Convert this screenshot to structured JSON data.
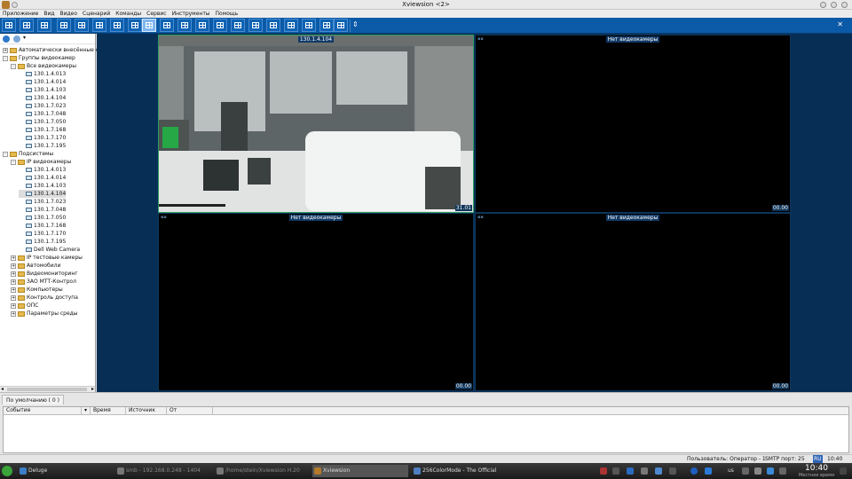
{
  "window": {
    "title": "Xviewsion <2>"
  },
  "menu": [
    "Приложение",
    "Вид",
    "Видео",
    "Сценарий",
    "Команды",
    "Сервис",
    "Инструменты",
    "Помощь"
  ],
  "tree": [
    {
      "level": 0,
      "type": "folder",
      "expand": "+",
      "label": "Автоматически внесённые объ"
    },
    {
      "level": 0,
      "type": "folder",
      "expand": "-",
      "label": "Группы видеокамер"
    },
    {
      "level": 1,
      "type": "folder",
      "expand": "-",
      "label": "Все видеокамеры"
    },
    {
      "level": 2,
      "type": "cam",
      "label": "130.1.4.013"
    },
    {
      "level": 2,
      "type": "cam",
      "label": "130.1.4.014"
    },
    {
      "level": 2,
      "type": "cam",
      "label": "130.1.4.103"
    },
    {
      "level": 2,
      "type": "cam",
      "label": "130.1.4.104"
    },
    {
      "level": 2,
      "type": "cam",
      "label": "130.1.7.023"
    },
    {
      "level": 2,
      "type": "cam",
      "label": "130.1.7.048"
    },
    {
      "level": 2,
      "type": "cam",
      "label": "130.1.7.050"
    },
    {
      "level": 2,
      "type": "cam",
      "label": "130.1.7.168"
    },
    {
      "level": 2,
      "type": "cam",
      "label": "130.1.7.170"
    },
    {
      "level": 2,
      "type": "cam",
      "label": "130.1.7.195"
    },
    {
      "level": 0,
      "type": "folder",
      "expand": "-",
      "label": "Подсистемы"
    },
    {
      "level": 1,
      "type": "folder",
      "expand": "-",
      "label": "IP видеокамеры"
    },
    {
      "level": 2,
      "type": "cam",
      "label": "130.1.4.013"
    },
    {
      "level": 2,
      "type": "cam",
      "label": "130.1.4.014"
    },
    {
      "level": 2,
      "type": "cam",
      "label": "130.1.4.103"
    },
    {
      "level": 2,
      "type": "cam",
      "label": "130.1.4.104",
      "selected": true
    },
    {
      "level": 2,
      "type": "cam",
      "label": "130.1.7.023"
    },
    {
      "level": 2,
      "type": "cam",
      "label": "130.1.7.048"
    },
    {
      "level": 2,
      "type": "cam",
      "label": "130.1.7.050"
    },
    {
      "level": 2,
      "type": "cam",
      "label": "130.1.7.168"
    },
    {
      "level": 2,
      "type": "cam",
      "label": "130.1.7.170"
    },
    {
      "level": 2,
      "type": "cam",
      "label": "130.1.7.195"
    },
    {
      "level": 2,
      "type": "cam",
      "label": "Dell Web Camera"
    },
    {
      "level": 1,
      "type": "folder",
      "expand": "+",
      "label": "IP тестовые камеры"
    },
    {
      "level": 1,
      "type": "folder",
      "expand": "+",
      "label": "Автомобили"
    },
    {
      "level": 1,
      "type": "folder",
      "expand": "+",
      "label": "Видеомониторинг"
    },
    {
      "level": 1,
      "type": "folder",
      "expand": "+",
      "label": "ЗАО МТТ-Контрол"
    },
    {
      "level": 1,
      "type": "folder",
      "expand": "+",
      "label": "Компьютеры"
    },
    {
      "level": 1,
      "type": "folder",
      "expand": "+",
      "label": "Контроль доступа"
    },
    {
      "level": 1,
      "type": "folder",
      "expand": "+",
      "label": "ОПС"
    },
    {
      "level": 1,
      "type": "folder",
      "expand": "+",
      "label": "Параметры среды"
    }
  ],
  "tiles": [
    {
      "label": "130.1.4.104",
      "time": "31.01",
      "active": true,
      "video": true
    },
    {
      "label": "Нет видеокамеры",
      "time": "00.00"
    },
    {
      "label": "Нет видеокамеры",
      "time": "00.00"
    },
    {
      "label": "Нет видеокамеры",
      "time": "00.00"
    }
  ],
  "events": {
    "tab": "По умолчанию ( 0 )",
    "columns": [
      "Событие",
      "Время",
      "Источник",
      "От"
    ]
  },
  "status": {
    "user": "Пользователь: Оператор - 1",
    "smtp": "SMTP порт: 25",
    "lang": "RU",
    "time": "10:40"
  },
  "taskbar": {
    "items": [
      {
        "label": "Deluge",
        "color": "#3d7ec6"
      },
      {
        "label": "smb - 192.168.0.248 - 1404",
        "color": "#777"
      },
      {
        "label": "/home/stein/Xviewsion H.20",
        "color": "#777"
      },
      {
        "label": "Xviewsion",
        "color": "#b47a2c"
      },
      {
        "label": "256ColorMode - The Official",
        "color": "#4f7fc0"
      }
    ],
    "clock": "10:40",
    "clock_label": "Местное время",
    "lang": "us"
  },
  "icons": {
    "refresh": "refresh-icon",
    "settings": "gear-icon",
    "layout_buttons": "layout-grid-icon",
    "start": "start-menu-icon"
  }
}
